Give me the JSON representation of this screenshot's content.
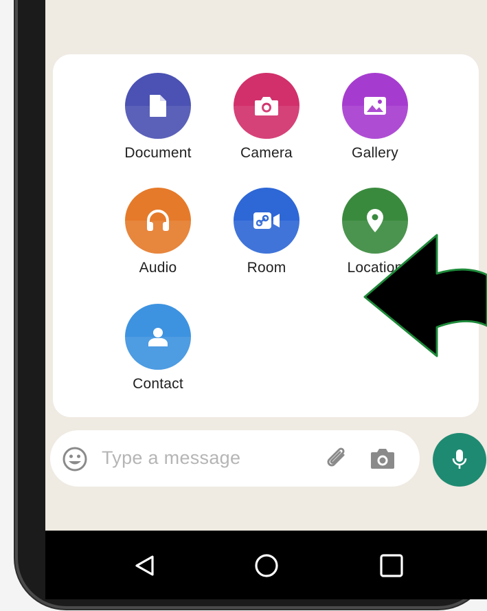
{
  "attach_menu": {
    "items": [
      {
        "label": "Document",
        "icon": "document-icon",
        "color_top": "#4b52b3",
        "color_bottom": "#5a60c8"
      },
      {
        "label": "Camera",
        "icon": "camera-icon",
        "color_top": "#d1306b",
        "color_bottom": "#e0407a"
      },
      {
        "label": "Gallery",
        "icon": "gallery-icon",
        "color_top": "#a63ccf",
        "color_bottom": "#b54fde"
      },
      {
        "label": "Audio",
        "icon": "headphones-icon",
        "color_top": "#e57a2a",
        "color_bottom": "#f08b3a"
      },
      {
        "label": "Room",
        "icon": "video-room-icon",
        "color_top": "#2e67d6",
        "color_bottom": "#3b75e4"
      },
      {
        "label": "Location",
        "icon": "location-pin-icon",
        "color_top": "#3a8a3e",
        "color_bottom": "#46994a"
      },
      {
        "label": "Contact",
        "icon": "contact-icon",
        "color_top": "#3d93e0",
        "color_bottom": "#4ca2ee"
      }
    ]
  },
  "compose": {
    "placeholder": "Type a message",
    "icons": [
      "emoji-icon",
      "attach-icon",
      "camera-icon"
    ]
  },
  "mic_button": {
    "icon": "microphone-icon",
    "color": "#1f8a72"
  },
  "nav_bar": {
    "buttons": [
      "back-icon",
      "home-icon",
      "recents-icon"
    ]
  },
  "annotation": {
    "type": "arrow",
    "color": "#000000",
    "outline": "#1e8a3a"
  }
}
